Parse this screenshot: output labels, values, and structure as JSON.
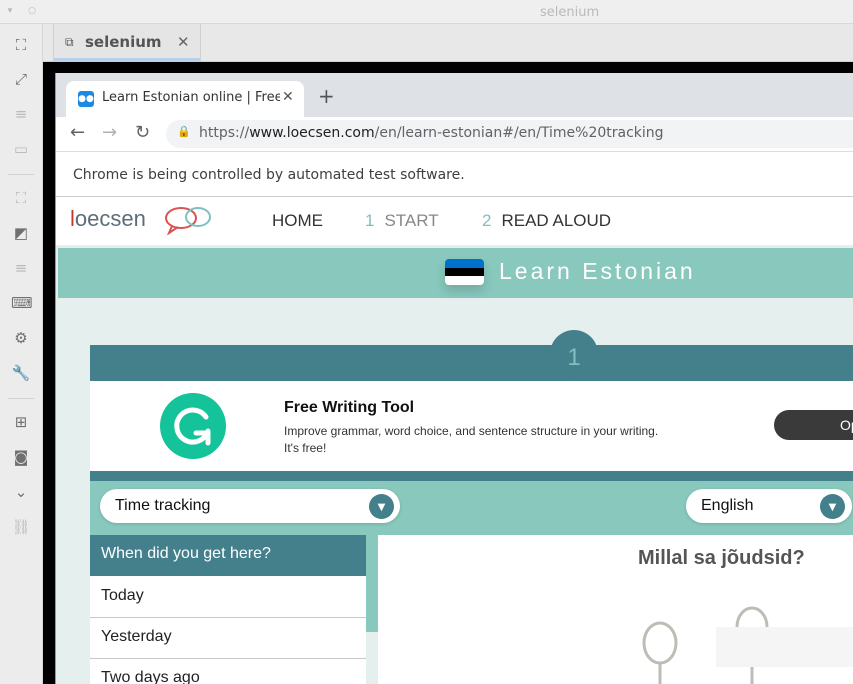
{
  "window": {
    "title": "selenium"
  },
  "tab": {
    "label": "selenium"
  },
  "sidebar": {
    "icons": [
      "select-icon",
      "fullscreen-icon",
      "menu-icon",
      "window-icon",
      "select-dim-icon",
      "resize-icon",
      "list-icon",
      "keyboard-icon",
      "settings-icon",
      "wrench-icon",
      "add-window-icon",
      "camera-icon",
      "chevron-down-icon",
      "link-icon"
    ]
  },
  "browser": {
    "tab_title": "Learn Estonian online | Free",
    "url_prefix": "https://",
    "url_host": "www.loecsen.com",
    "url_path": "/en/learn-estonian#/en/Time%20tracking",
    "infobar": "Chrome is being controlled by automated test software."
  },
  "site": {
    "logo": "loecsen",
    "menu": [
      {
        "num": "",
        "label": "HOME"
      },
      {
        "num": "1",
        "label": "START"
      },
      {
        "num": "2",
        "label": "READ ALOUD"
      }
    ],
    "hero_title": "Learn Estonian",
    "flag_colors": [
      "#0072ce",
      "#000000",
      "#ffffff"
    ],
    "step": "1",
    "ad": {
      "title": "Free Writing Tool",
      "text": "Improve grammar, word choice, and sentence structure in your writing. It's free!",
      "button": "Op"
    },
    "topic_select": "Time tracking",
    "language_select": "English",
    "phrases": [
      "When did you get here?",
      "Today",
      "Yesterday",
      "Two days ago"
    ],
    "question": "Millal sa jõudsid?"
  },
  "colors": {
    "teal_dark": "#447f8c",
    "teal_light": "#88c8bd",
    "grammarly_green": "#15c39a"
  }
}
